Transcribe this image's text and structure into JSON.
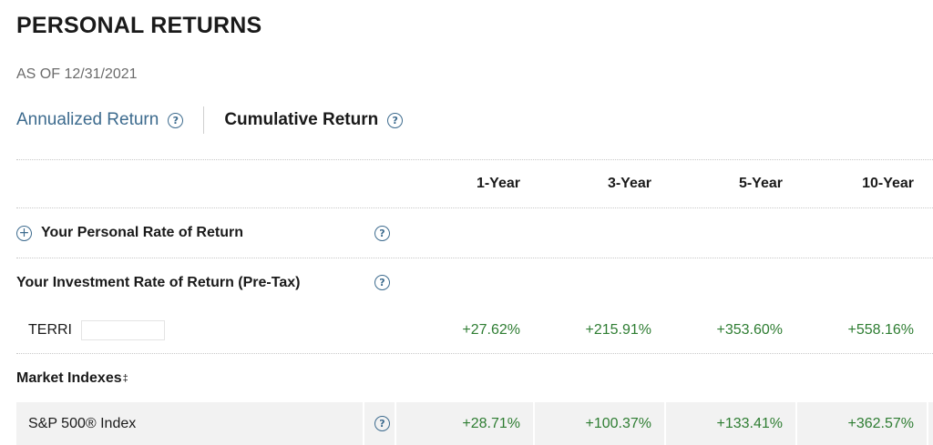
{
  "page": {
    "title": "PERSONAL RETURNS",
    "as_of": "AS OF 12/31/2021"
  },
  "tabs": [
    {
      "label": "Annualized Return",
      "active": false
    },
    {
      "label": "Cumulative Return",
      "active": true
    }
  ],
  "help_glyph": "?",
  "expand_glyph": "+",
  "table": {
    "columns": [
      "1-Year",
      "3-Year",
      "5-Year",
      "10-Year"
    ],
    "personal_row": {
      "label": "Your Personal Rate of Return"
    },
    "investment_header": {
      "label": "Your Investment Rate of Return (Pre-Tax)"
    },
    "account_row": {
      "label": "TERRI",
      "values": [
        "+27.62%",
        "+215.91%",
        "+353.60%",
        "+558.16%"
      ]
    },
    "market_header": {
      "label": "Market Indexes",
      "mark": "‡"
    },
    "index_row": {
      "label": "S&P 500® Index",
      "values": [
        "+28.71%",
        "+100.37%",
        "+133.41%",
        "+362.57%"
      ]
    }
  },
  "colors": {
    "link": "#3d6b8e",
    "positive": "#2e7d32",
    "muted": "#6b6b6b",
    "row_highlight": "#f2f2f2"
  }
}
